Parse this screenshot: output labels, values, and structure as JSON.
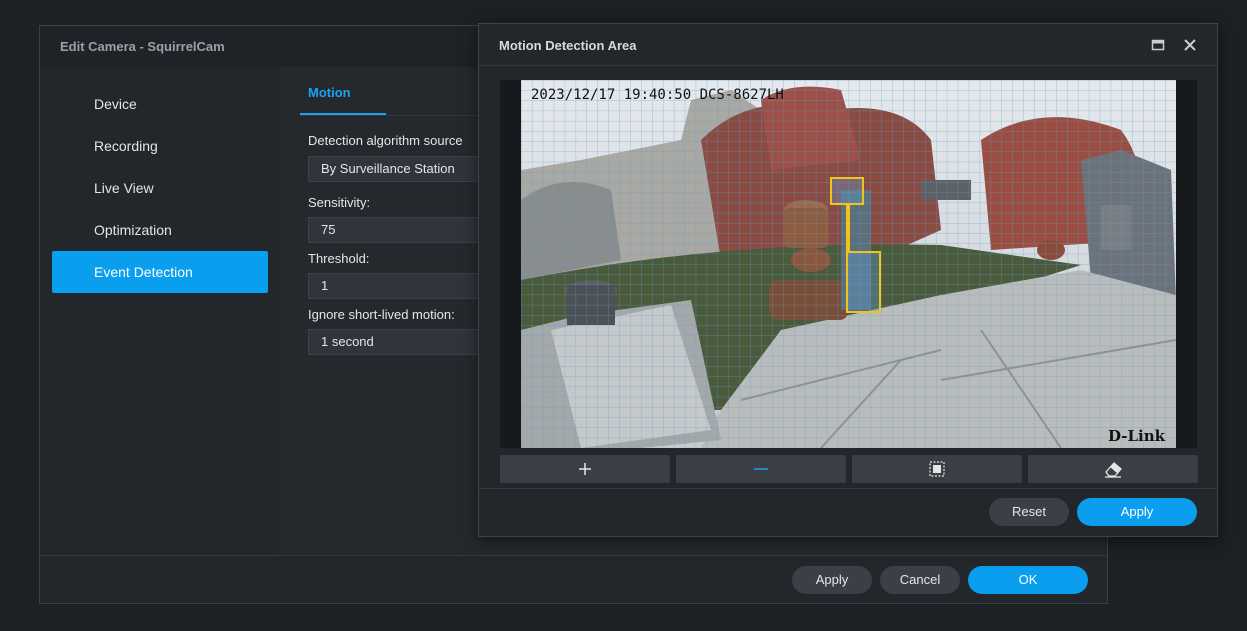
{
  "edit_window": {
    "title": "Edit Camera - SquirrelCam",
    "sidebar": [
      {
        "label": "Device"
      },
      {
        "label": "Recording"
      },
      {
        "label": "Live View"
      },
      {
        "label": "Optimization"
      },
      {
        "label": "Event Detection",
        "active": true
      }
    ],
    "tab": "Motion",
    "fields": {
      "algorithm_label": "Detection algorithm source",
      "algorithm_value": "By Surveillance Station",
      "sensitivity_label": "Sensitivity:",
      "sensitivity_value": "75",
      "threshold_label": "Threshold:",
      "threshold_value": "1",
      "ignore_label": "Ignore short-lived motion:",
      "ignore_value": "1 second"
    },
    "footer": {
      "apply": "Apply",
      "cancel": "Cancel",
      "ok": "OK"
    }
  },
  "motion_dialog": {
    "title": "Motion Detection Area",
    "camera_overlay": {
      "timestamp": "2023/12/17  19:40:50  DCS-8627LH",
      "brand": "D-Link"
    },
    "tools": [
      {
        "icon": "plus-icon"
      },
      {
        "icon": "minus-icon"
      },
      {
        "icon": "select-all-icon"
      },
      {
        "icon": "eraser-icon"
      }
    ],
    "footer": {
      "reset": "Reset",
      "apply": "Apply"
    }
  },
  "colors": {
    "accent": "#0a9eef",
    "area_outline": "#f0c419",
    "grid": "#5b9fd8"
  }
}
